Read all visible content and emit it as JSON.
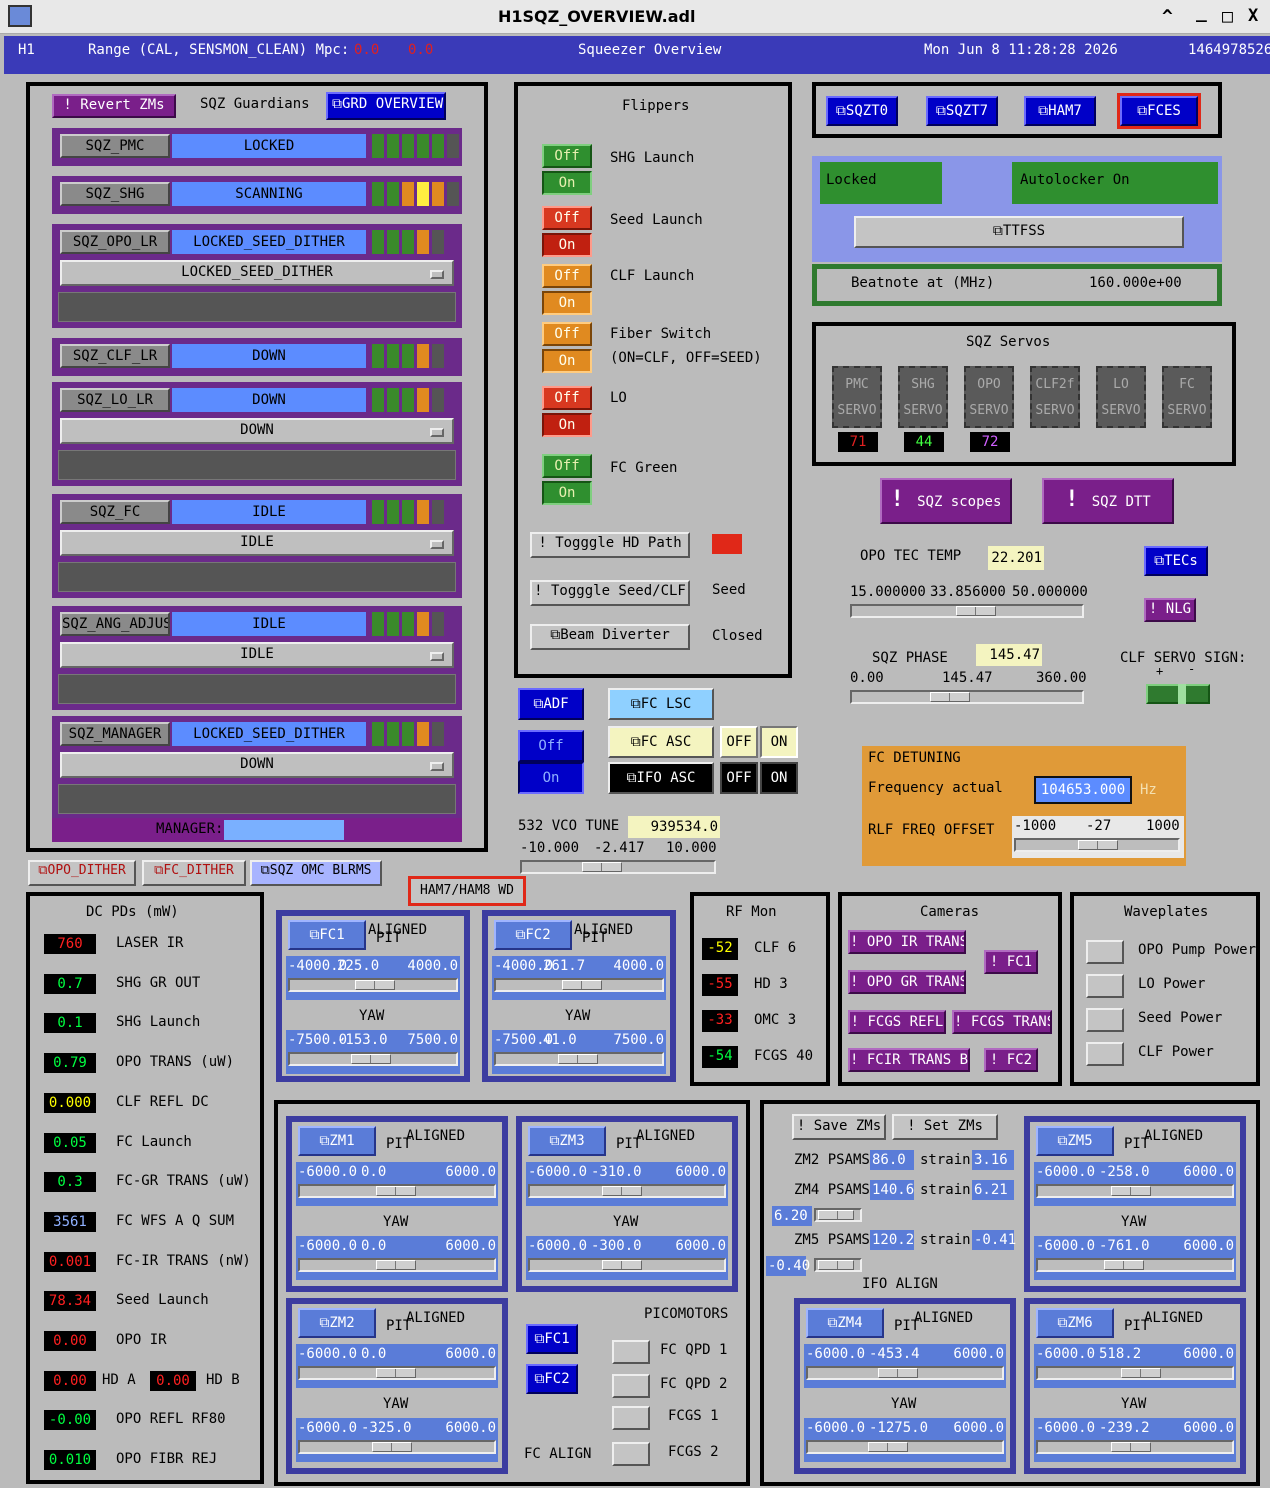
{
  "window": {
    "title": "H1SQZ_OVERVIEW.adl",
    "controls": [
      "^",
      "_",
      "□",
      "X"
    ]
  },
  "header": {
    "ifo": "H1",
    "range_label": "Range (CAL, SENSMON_CLEAN) Mpc:",
    "range_val1": "0.0",
    "range_val2": "0.0",
    "center_title": "Squeezer Overview",
    "date": "Mon Jun  8 11:28:28 2026",
    "gps": "1464978526"
  },
  "guardians": {
    "revert": "! Revert ZMs",
    "title": "SQZ Guardians",
    "overview": "GRD OVERVIEW",
    "rows": [
      {
        "name": "SQZ_PMC",
        "state": "LOCKED",
        "leds": [
          "#3a8a2a",
          "#3a8a2a",
          "#3a8a2a",
          "#3a8a2a",
          "#3a8a2a",
          "#555555"
        ]
      },
      {
        "name": "SQZ_SHG",
        "state": "SCANNING",
        "leds": [
          "#3a8a2a",
          "#3a8a2a",
          "#e08a20",
          "#ffee40",
          "#e08a20",
          "#555555"
        ]
      },
      {
        "name": "SQZ_OPO_LR",
        "state": "LOCKED_SEED_DITHER",
        "leds": [
          "#3a8a2a",
          "#3a8a2a",
          "#3a8a2a",
          "#e08a20",
          "#555555"
        ],
        "menu": "LOCKED_SEED_DITHER"
      },
      {
        "name": "SQZ_CLF_LR",
        "state": "DOWN",
        "leds": [
          "#3a8a2a",
          "#3a8a2a",
          "#3a8a2a",
          "#e08a20",
          "#555555"
        ]
      },
      {
        "name": "SQZ_LO_LR",
        "state": "DOWN",
        "leds": [
          "#3a8a2a",
          "#3a8a2a",
          "#3a8a2a",
          "#e08a20",
          "#555555"
        ],
        "menu": "DOWN"
      },
      {
        "name": "SQZ_FC",
        "state": "IDLE",
        "leds": [
          "#3a8a2a",
          "#3a8a2a",
          "#3a8a2a",
          "#e08a20",
          "#555555"
        ],
        "menu": "IDLE"
      },
      {
        "name": "SQZ_ANG_ADJUST",
        "state": "IDLE",
        "leds": [
          "#3a8a2a",
          "#3a8a2a",
          "#3a8a2a",
          "#e08a20",
          "#555555"
        ],
        "menu": "IDLE"
      },
      {
        "name": "SQZ_MANAGER",
        "state": "LOCKED_SEED_DITHER",
        "leds": [
          "#3a8a2a",
          "#3a8a2a",
          "#3a8a2a",
          "#e08a20",
          "#555555"
        ],
        "menu": "DOWN"
      }
    ],
    "manager_label": "MANAGER:"
  },
  "dither_buttons": [
    "OPO_DITHER",
    "FC_DITHER",
    "SQZ OMC BLRMS"
  ],
  "flippers": {
    "title": "Flippers",
    "off": "Off",
    "on": "On",
    "items": [
      "SHG Launch",
      "Seed Launch",
      "CLF Launch",
      "Fiber Switch",
      "(ON=CLF, OFF=SEED)",
      "LO",
      "FC Green"
    ],
    "toggle_hd": "! Togggle HD Path",
    "toggle_seed": "! Togggle Seed/CLF",
    "seed_state": "Seed",
    "beam_div": "Beam Diverter",
    "beam_state": "Closed"
  },
  "adf": {
    "adf": "ADF",
    "off": "Off",
    "on": "On",
    "fc_lsc": "FC LSC",
    "fc_asc": "FC ASC",
    "ifo_asc": "IFO ASC",
    "off2": "OFF",
    "on2": "ON"
  },
  "vco": {
    "label": "532 VCO TUNE",
    "value": "939534.0",
    "min": "-10.000",
    "cur": "-2.417",
    "max": "10.000"
  },
  "top_right": {
    "links": [
      "SQZT0",
      "SQZT7",
      "HAM7",
      "FCES"
    ],
    "locked": "Locked",
    "autolocker": "Autolocker On",
    "ttfss": "TTFSS",
    "beat_label": "Beatnote at (MHz)",
    "beat_val": "160.000e+00"
  },
  "servos": {
    "title": "SQZ Servos",
    "chips": [
      {
        "a": "PMC",
        "b": "SERVO",
        "v": "71"
      },
      {
        "a": "SHG",
        "b": "SERVO",
        "v": "44"
      },
      {
        "a": "OPO",
        "b": "SERVO",
        "v": "72"
      },
      {
        "a": "CLF2f",
        "b": "SERVO",
        "v": ""
      },
      {
        "a": "LO",
        "b": "SERVO",
        "v": ""
      },
      {
        "a": "FC",
        "b": "SERVO",
        "v": ""
      }
    ]
  },
  "scopes": {
    "scopes": "SQZ scopes",
    "dtt": "SQZ DTT"
  },
  "tec": {
    "label": "OPO TEC TEMP",
    "value": "22.201",
    "min": "15.000000",
    "cur": "33.856000",
    "max": "50.000000",
    "tecs": "TECs",
    "nlg": "! NLG"
  },
  "phase": {
    "label": "SQZ PHASE",
    "value": "145.47",
    "min": "0.00",
    "cur": "145.47",
    "max": "360.00",
    "clf_sign": "CLF SERVO SIGN:",
    "plus": "+",
    "minus": "-"
  },
  "fc_detune": {
    "title": "FC DETUNING",
    "freq_label": "Frequency actual",
    "freq_val": "104653.000",
    "hz": "Hz",
    "rlf_label": "RLF FREQ OFFSET",
    "min": "-1000",
    "cur": "-27",
    "max": "1000"
  },
  "ham_wd": "HAM7/HAM8 WD",
  "dcpds": {
    "title": "DC PDs (mW)",
    "rows": [
      {
        "v": "760",
        "c": "rv",
        "l": "LASER IR"
      },
      {
        "v": "0.7",
        "c": "gv",
        "l": "SHG GR OUT"
      },
      {
        "v": "0.1",
        "c": "gv",
        "l": "SHG Launch"
      },
      {
        "v": "0.79",
        "c": "gv",
        "l": "OPO TRANS (uW)"
      },
      {
        "v": "0.000",
        "c": "yv",
        "l": "CLF REFL DC"
      },
      {
        "v": "0.05",
        "c": "gv",
        "l": "FC Launch"
      },
      {
        "v": "0.3",
        "c": "gv",
        "l": "FC-GR TRANS (uW)"
      },
      {
        "v": "3561",
        "c": "bv",
        "l": "FC WFS A Q SUM"
      },
      {
        "v": "0.001",
        "c": "rv",
        "l": "FC-IR TRANS (nW)"
      },
      {
        "v": "78.34",
        "c": "rv",
        "l": "Seed Launch"
      },
      {
        "v": "0.00",
        "c": "rv",
        "l": "OPO IR"
      },
      {
        "v": "0.00",
        "c": "rv",
        "l": "HD A",
        "v2": "0.00",
        "l2": "HD B"
      },
      {
        "v": "-0.00",
        "c": "gv",
        "l": "OPO REFL RF80"
      },
      {
        "v": "0.010",
        "c": "gv",
        "l": "OPO FIBR REJ"
      }
    ]
  },
  "fc_sus": [
    {
      "name": "FC1",
      "pit": "PIT",
      "st": "ALIGNED",
      "pmin": "-4000.0",
      "pval": "225.0",
      "pmax": "4000.0",
      "yaw": "YAW",
      "ymin": "-7500.0",
      "yval": "-153.0",
      "ymax": "7500.0"
    },
    {
      "name": "FC2",
      "pit": "PIT",
      "st": "ALIGNED",
      "pmin": "-4000.0",
      "pval": "261.7",
      "pmax": "4000.0",
      "yaw": "YAW",
      "ymin": "-7500.0",
      "yval": "41.0",
      "ymax": "7500.0"
    }
  ],
  "rfmon": {
    "title": "RF Mon",
    "rows": [
      {
        "v": "-52",
        "c": "yv",
        "l": "CLF 6"
      },
      {
        "v": "-55",
        "c": "rv",
        "l": "HD 3"
      },
      {
        "v": "-33",
        "c": "rv",
        "l": "OMC 3"
      },
      {
        "v": "-54",
        "c": "gv",
        "l": "FCGS 40"
      }
    ]
  },
  "cameras": {
    "title": "Cameras",
    "b": [
      "! OPO IR TRANS",
      "! OPO GR TRANS",
      "! FCGS REFL",
      "! FCGS TRANS",
      "! FCIR TRANS B",
      "! FC1",
      "! FC2"
    ]
  },
  "waveplates": {
    "title": "Waveplates",
    "items": [
      "OPO Pump Power",
      "LO Power",
      "Seed Power",
      "CLF Power"
    ]
  },
  "zms": [
    {
      "name": "ZM1",
      "pit": "PIT",
      "st": "ALIGNED",
      "pmin": "-6000.0",
      "pval": "0.0",
      "pmax": "6000.0",
      "yaw": "YAW",
      "ymin": "-6000.0",
      "yval": "0.0",
      "ymax": "6000.0"
    },
    {
      "name": "ZM3",
      "pit": "PIT",
      "st": "ALIGNED",
      "pmin": "-6000.0",
      "pval": "-310.0",
      "pmax": "6000.0",
      "yaw": "YAW",
      "ymin": "-6000.0",
      "yval": "-300.0",
      "ymax": "6000.0"
    },
    {
      "name": "ZM2",
      "pit": "PIT",
      "st": "ALIGNED",
      "pmin": "-6000.0",
      "pval": "0.0",
      "pmax": "6000.0",
      "yaw": "YAW",
      "ymin": "-6000.0",
      "yval": "-325.0",
      "ymax": "6000.0"
    },
    {
      "name": "ZM5",
      "pit": "PIT",
      "st": "ALIGNED",
      "pmin": "-6000.0",
      "pval": "-258.0",
      "pmax": "6000.0",
      "yaw": "YAW",
      "ymin": "-6000.0",
      "yval": "-761.0",
      "ymax": "6000.0"
    },
    {
      "name": "ZM4",
      "pit": "PIT",
      "st": "ALIGNED",
      "pmin": "-6000.0",
      "pval": "-453.4",
      "pmax": "6000.0",
      "yaw": "YAW",
      "ymin": "-6000.0",
      "yval": "-1275.0",
      "ymax": "6000.0"
    },
    {
      "name": "ZM6",
      "pit": "PIT",
      "st": "ALIGNED",
      "pmin": "-6000.0",
      "pval": "518.2",
      "pmax": "6000.0",
      "yaw": "YAW",
      "ymin": "-6000.0",
      "yval": "-239.2",
      "ymax": "6000.0"
    }
  ],
  "picomotors": {
    "title": "PICOMOTORS",
    "fc1": "FC1",
    "fc2": "FC2",
    "items": [
      "FC QPD 1",
      "FC QPD 2",
      "FCGS 1",
      "FCGS 2"
    ],
    "fc_align": "FC ALIGN"
  },
  "ifo_align": {
    "save": "! Save ZMs",
    "set": "! Set ZMs",
    "title": "IFO ALIGN",
    "psams": [
      {
        "l": "ZM2 PSAMS",
        "v": "86.0",
        "s": "strain",
        "sv": "3.16"
      },
      {
        "l": "ZM4 PSAMS",
        "v": "140.6",
        "s": "strain",
        "sv": "6.21",
        "set": "6.20"
      },
      {
        "l": "ZM5 PSAMS",
        "v": "120.2",
        "s": "strain",
        "sv": "-0.41",
        "set": "-0.40"
      }
    ]
  }
}
